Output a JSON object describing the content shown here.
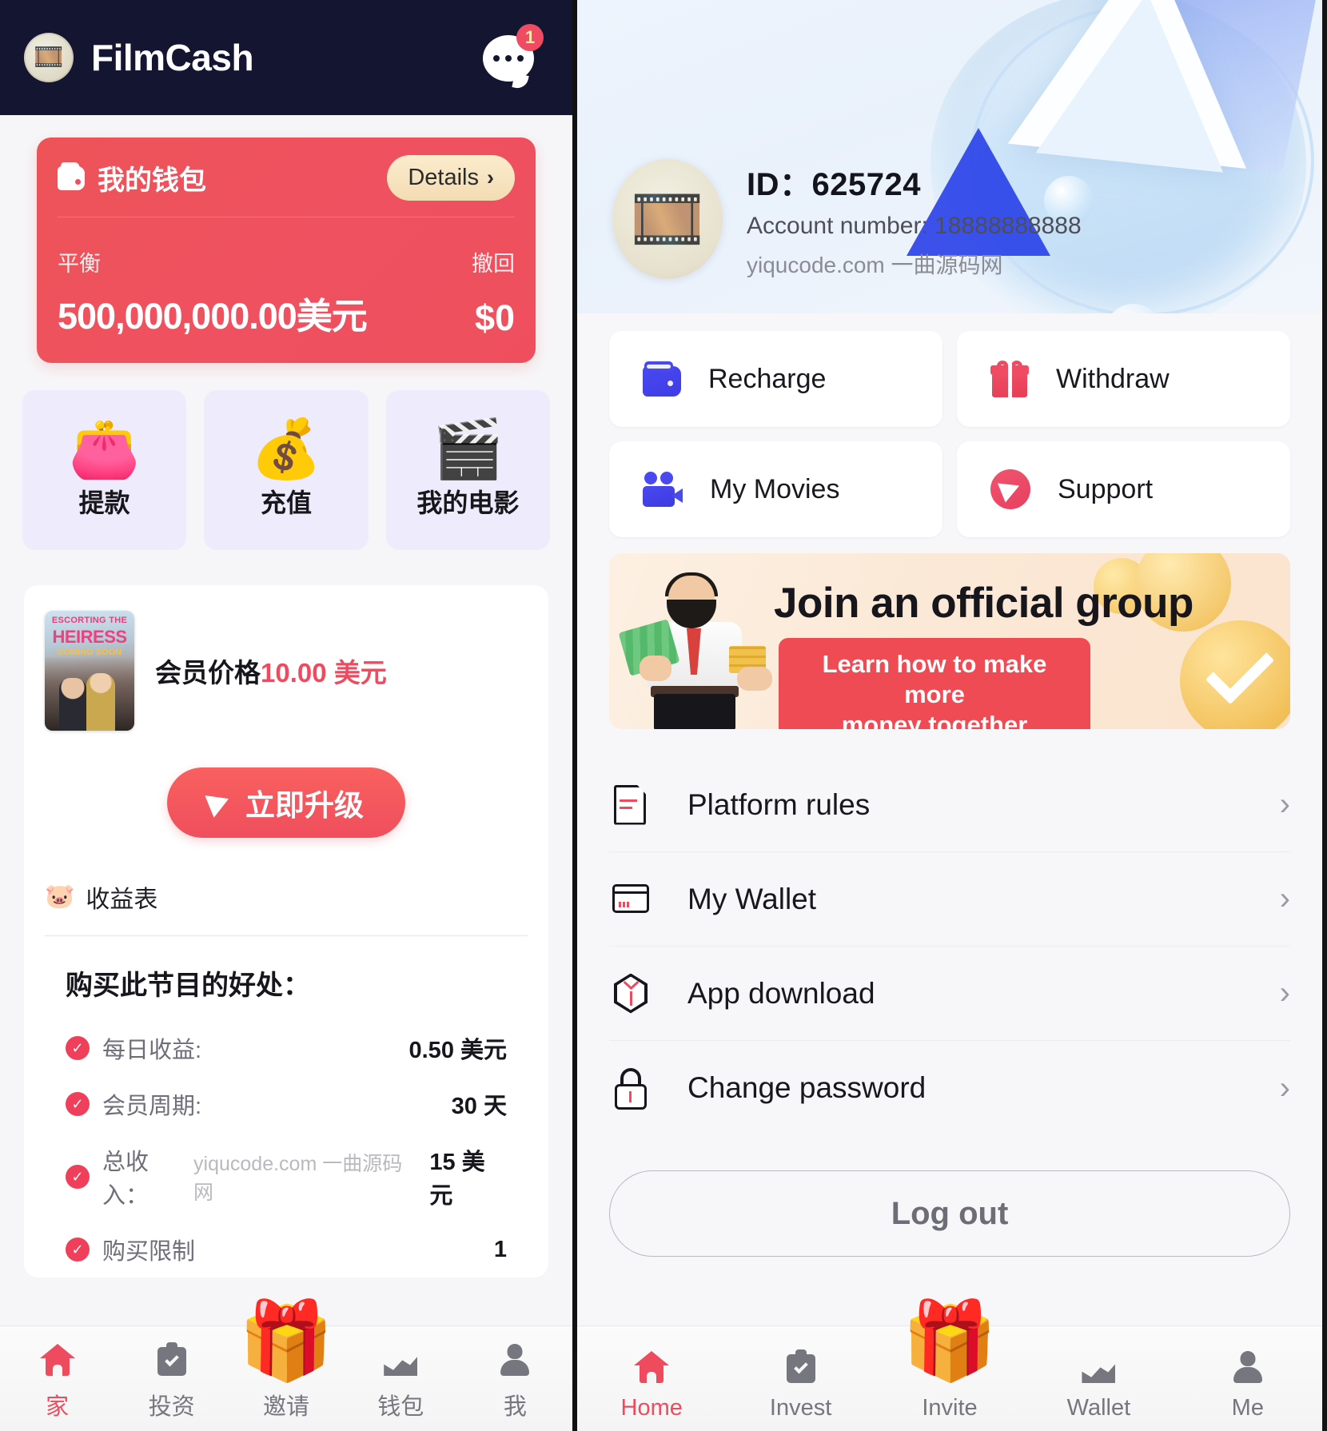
{
  "left": {
    "header": {
      "app_title": "FilmCash",
      "logo_icon": "film-money-logo",
      "chat_icon": "chat-bubble-icon",
      "chat_badge_count": "1"
    },
    "wallet_card": {
      "icon": "wallet-icon",
      "title": "我的钱包",
      "details_label": "Details",
      "chevron": "›",
      "balance_label": "平衡",
      "balance_value": "500,000,000.00美元",
      "withdraw_label": "撤回",
      "withdraw_value": "$0"
    },
    "tiles": [
      {
        "icon": "wallet-3d-icon",
        "emoji": "👛",
        "label": "提款"
      },
      {
        "icon": "recharge-3d-icon",
        "emoji": "💰",
        "label": "充值"
      },
      {
        "icon": "movie-camera-3d-icon",
        "emoji": "🎬",
        "label": "我的电影"
      }
    ],
    "movie_card": {
      "poster": {
        "line1": "ESCORTING THE",
        "line2": "HEIRESS",
        "line3": "COMING SOON"
      },
      "price_label": "会员价格",
      "price_amount": "10.00",
      "price_unit": " 美元",
      "upgrade_label": "立即升级",
      "upgrade_icon": "send-plane-icon",
      "earnings_icon": "piggy-bank-icon",
      "earnings_label": "收益表"
    },
    "benefits": {
      "title": "购买此节目的好处：",
      "rows": [
        {
          "check": "✓",
          "label": "每日收益:",
          "watermark": "",
          "value": "0.50 美元"
        },
        {
          "check": "✓",
          "label": "会员周期:",
          "watermark": "",
          "value": "30 天"
        },
        {
          "check": "✓",
          "label": "总收入：",
          "watermark": "yiqucode.com 一曲源码网",
          "value": "15 美元"
        },
        {
          "check": "✓",
          "label": "购买限制",
          "watermark": "",
          "value": "1"
        }
      ]
    },
    "tabbar": [
      {
        "icon": "home-icon",
        "label": "家",
        "active": true
      },
      {
        "icon": "clipboard-check-icon",
        "label": "投资",
        "active": false
      },
      {
        "icon": "invite-treasure-icon",
        "emoji": "🎁",
        "label": "邀请",
        "active": false,
        "raised": true
      },
      {
        "icon": "chart-icon",
        "label": "钱包",
        "active": false
      },
      {
        "icon": "person-icon",
        "label": "我",
        "active": false
      }
    ]
  },
  "right": {
    "profile": {
      "avatar_icon": "film-money-avatar",
      "id_label": "ID：625724",
      "account_label": "Account number: 18888888888",
      "watermark": "yiqucode.com 一曲源码网"
    },
    "quick_actions": [
      {
        "icon": "wallet-icon",
        "label": "Recharge"
      },
      {
        "icon": "gift-icon",
        "label": "Withdraw"
      },
      {
        "icon": "video-camera-icon",
        "label": "My Movies"
      },
      {
        "icon": "send-plane-icon",
        "label": "Support"
      }
    ],
    "banner": {
      "title": "Join an official group",
      "cta_line1": "Learn how to make more",
      "cta_line2": "money together",
      "illustration": "man-with-money-icon",
      "check_icon": "check-circle-icon"
    },
    "menu": [
      {
        "icon": "document-icon",
        "label": "Platform rules",
        "arrow": "›"
      },
      {
        "icon": "card-icon",
        "label": "My Wallet",
        "arrow": "›"
      },
      {
        "icon": "hexagon-download-icon",
        "label": "App download",
        "arrow": "›"
      },
      {
        "icon": "lock-icon",
        "label": "Change password",
        "arrow": "›"
      }
    ],
    "logout_label": "Log out",
    "tabbar": [
      {
        "icon": "home-icon",
        "label": "Home",
        "active": true
      },
      {
        "icon": "clipboard-check-icon",
        "label": "Invest",
        "active": false
      },
      {
        "icon": "invite-treasure-icon",
        "emoji": "🎁",
        "label": "Invite",
        "active": false,
        "raised": true
      },
      {
        "icon": "chart-icon",
        "label": "Wallet",
        "active": false
      },
      {
        "icon": "person-icon",
        "label": "Me",
        "active": false
      }
    ]
  },
  "colors": {
    "brand_red": "#ef4b5f",
    "header_navy": "#141530",
    "tile_lavender": "#eeebfd",
    "accent_blue": "#4a49f0",
    "gold": "#f3dcb4"
  }
}
